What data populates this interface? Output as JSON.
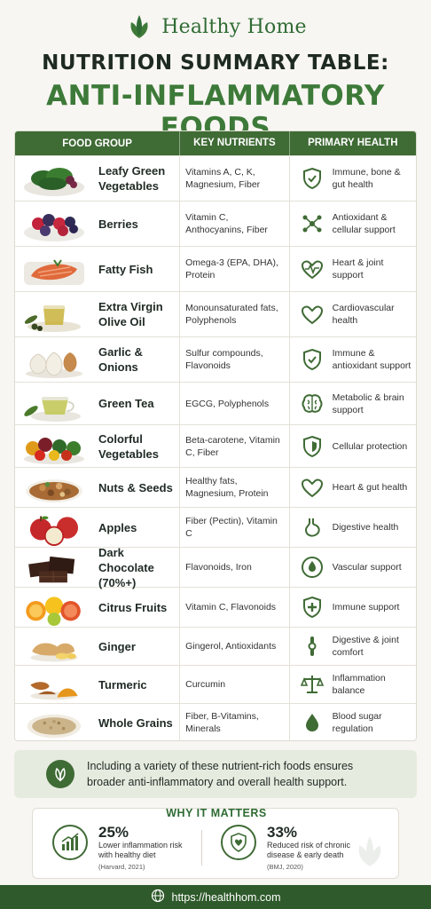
{
  "brand": {
    "name": "Healthy Home",
    "logo_icon": "leaf-icon"
  },
  "title": {
    "line1": "NUTRITION SUMMARY TABLE:",
    "line2": "ANTI-INFLAMMATORY FOODS"
  },
  "table": {
    "headers": [
      "FOOD GROUP",
      "KEY NUTRIENTS",
      "PRIMARY HEALTH SUPPORT"
    ],
    "rows": [
      {
        "food": "Leafy Green Vegetables",
        "nutrients": "Vitamins A, C, K, Magnesium, Fiber",
        "support": "Immune, bone & gut health",
        "icon": "shield-check-icon",
        "image": "leafy-greens-image"
      },
      {
        "food": "Berries",
        "nutrients": "Vitamin C, Anthocyanins, Fiber",
        "support": "Antioxidant & cellular support",
        "icon": "molecule-icon",
        "image": "berries-image"
      },
      {
        "food": "Fatty Fish",
        "nutrients": "Omega-3 (EPA, DHA), Protein",
        "support": "Heart & joint support",
        "icon": "heartbeat-icon",
        "image": "salmon-image"
      },
      {
        "food": "Extra Virgin Olive Oil",
        "nutrients": "Monounsaturated fats, Polyphenols",
        "support": "Cardiovascular health",
        "icon": "heart-icon",
        "image": "olive-oil-image"
      },
      {
        "food": "Garlic & Onions",
        "nutrients": "Sulfur compounds, Flavonoids",
        "support": "Immune & antioxidant support",
        "icon": "shield-check-icon",
        "image": "garlic-image"
      },
      {
        "food": "Green Tea",
        "nutrients": "EGCG, Polyphenols",
        "support": "Metabolic & brain support",
        "icon": "brain-icon",
        "image": "green-tea-image"
      },
      {
        "food": "Colorful Vegetables",
        "nutrients": "Beta-carotene, Vitamin C, Fiber",
        "support": "Cellular protection",
        "icon": "shield-icon",
        "image": "vegetables-image"
      },
      {
        "food": "Nuts & Seeds",
        "nutrients": "Healthy fats, Magnesium, Protein",
        "support": "Heart & gut health",
        "icon": "heart-icon",
        "image": "nuts-image"
      },
      {
        "food": "Apples",
        "nutrients": "Fiber (Pectin), Vitamin C",
        "support": "Digestive health",
        "icon": "stomach-icon",
        "image": "apples-image"
      },
      {
        "food": "Dark Chocolate (70%+)",
        "nutrients": "Flavonoids, Iron",
        "support": "Vascular support",
        "icon": "drop-circle-icon",
        "image": "chocolate-image"
      },
      {
        "food": "Citrus Fruits",
        "nutrients": "Vitamin C, Flavonoids",
        "support": "Immune support",
        "icon": "shield-plus-icon",
        "image": "citrus-image"
      },
      {
        "food": "Ginger",
        "nutrients": "Gingerol, Antioxidants",
        "support": "Digestive & joint comfort",
        "icon": "joint-icon",
        "image": "ginger-image"
      },
      {
        "food": "Turmeric",
        "nutrients": "Curcumin",
        "support": "Inflammation balance",
        "icon": "scale-icon",
        "image": "turmeric-image"
      },
      {
        "food": "Whole Grains",
        "nutrients": "Fiber, B-Vitamins, Minerals",
        "support": "Blood sugar regulation",
        "icon": "drop-icon",
        "image": "grains-image"
      }
    ]
  },
  "note": {
    "text": "Including a variety of these nutrient-rich foods ensures broader anti-inflammatory and overall health support.",
    "icon": "leaf-icon"
  },
  "why": {
    "title": "WHY IT MATTERS",
    "stats": [
      {
        "value": "25%",
        "desc": "Lower inflammation risk with healthy diet",
        "source": "(Harvard, 2021)",
        "icon": "chart-up-icon"
      },
      {
        "value": "33%",
        "desc": "Reduced risk of chronic disease & early death",
        "source": "(BMJ, 2020)",
        "icon": "shield-heart-icon"
      }
    ]
  },
  "footer": {
    "url": "https://healthhom.com",
    "icon": "globe-icon"
  },
  "colors": {
    "accent": "#3f6b35",
    "title_green": "#3d7a39",
    "background": "#f7f6f2"
  }
}
